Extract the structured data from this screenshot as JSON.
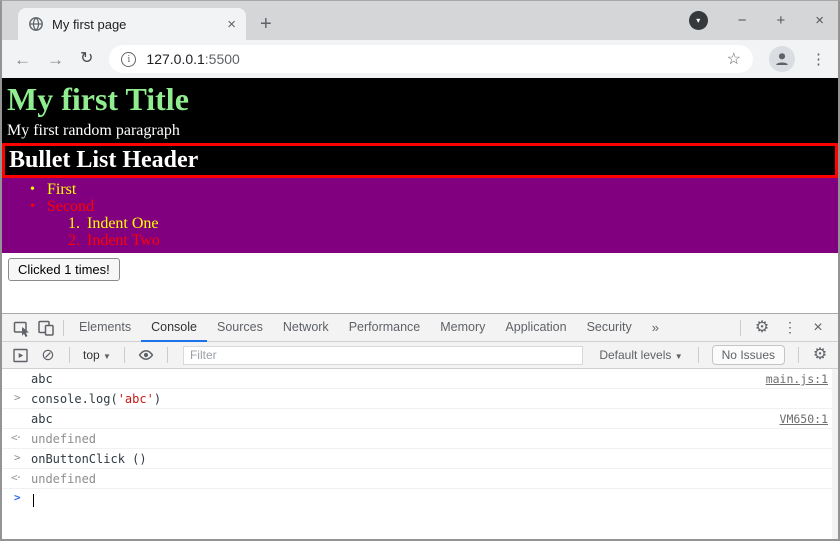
{
  "browser": {
    "tab_title": "My first page",
    "tab_close_glyph": "×",
    "new_tab_glyph": "+",
    "menu_caret_glyph": "▾",
    "minimize_glyph": "−",
    "maximize_glyph": "+",
    "close_glyph": "×",
    "back_glyph": "←",
    "forward_glyph": "→",
    "reload_glyph": "↻",
    "info_glyph": "i",
    "url_host": "127.0.0.1",
    "url_port": ":5500",
    "bookmark_star_glyph": "☆",
    "menu_dots_glyph": "⋮"
  },
  "page": {
    "heading": "My first Title",
    "paragraph": "My first random paragraph",
    "list_header": "Bullet List Header",
    "bullet_glyph": "•",
    "items": [
      {
        "label": "First",
        "color": "#ffff00"
      },
      {
        "label": "Second",
        "color": "#ff0000"
      }
    ],
    "sub_items": [
      {
        "number": "1.",
        "label": "Indent One",
        "color": "#ffff00"
      },
      {
        "number": "2.",
        "label": "Indent Two",
        "color": "#ff0000"
      }
    ],
    "button_label": "Clicked 1 times!",
    "colors": {
      "heading_green": "#90ee90",
      "section_black": "#000000",
      "list_purple": "#800080",
      "header_border_red": "#ff0000"
    }
  },
  "devtools": {
    "tabs": [
      {
        "label": "Elements"
      },
      {
        "label": "Console"
      },
      {
        "label": "Sources"
      },
      {
        "label": "Network"
      },
      {
        "label": "Performance"
      },
      {
        "label": "Memory"
      },
      {
        "label": "Application"
      },
      {
        "label": "Security"
      }
    ],
    "active_tab": "Console",
    "overflow_glyph": "»",
    "menu_dots_glyph": "⋮",
    "close_glyph": "×",
    "gear_glyph": "⚙",
    "block_glyph": "⊘",
    "toolbar": {
      "context_selector": "top",
      "caret_glyph": "▼",
      "filter_placeholder": "Filter",
      "levels_label": "Default levels",
      "issues_label": "No Issues"
    },
    "console": {
      "command_glyph": ">",
      "result_glyph": "<·",
      "prompt_glyph": ">",
      "rows": [
        {
          "kind": "log",
          "text": "abc",
          "link": "main.js:1"
        },
        {
          "kind": "command",
          "code_pre": "console.log(",
          "code_string": "'abc'",
          "code_post": ")"
        },
        {
          "kind": "log",
          "text": "abc",
          "link": "VM650:1"
        },
        {
          "kind": "result",
          "text": "undefined"
        },
        {
          "kind": "command",
          "code_pre": "onButtonClick ()",
          "code_string": "",
          "code_post": ""
        },
        {
          "kind": "result",
          "text": "undefined"
        }
      ]
    },
    "colors": {
      "accent_blue": "#1a73e8",
      "string_red": "#c41a16",
      "prompt_blue": "#2a6df4"
    }
  }
}
